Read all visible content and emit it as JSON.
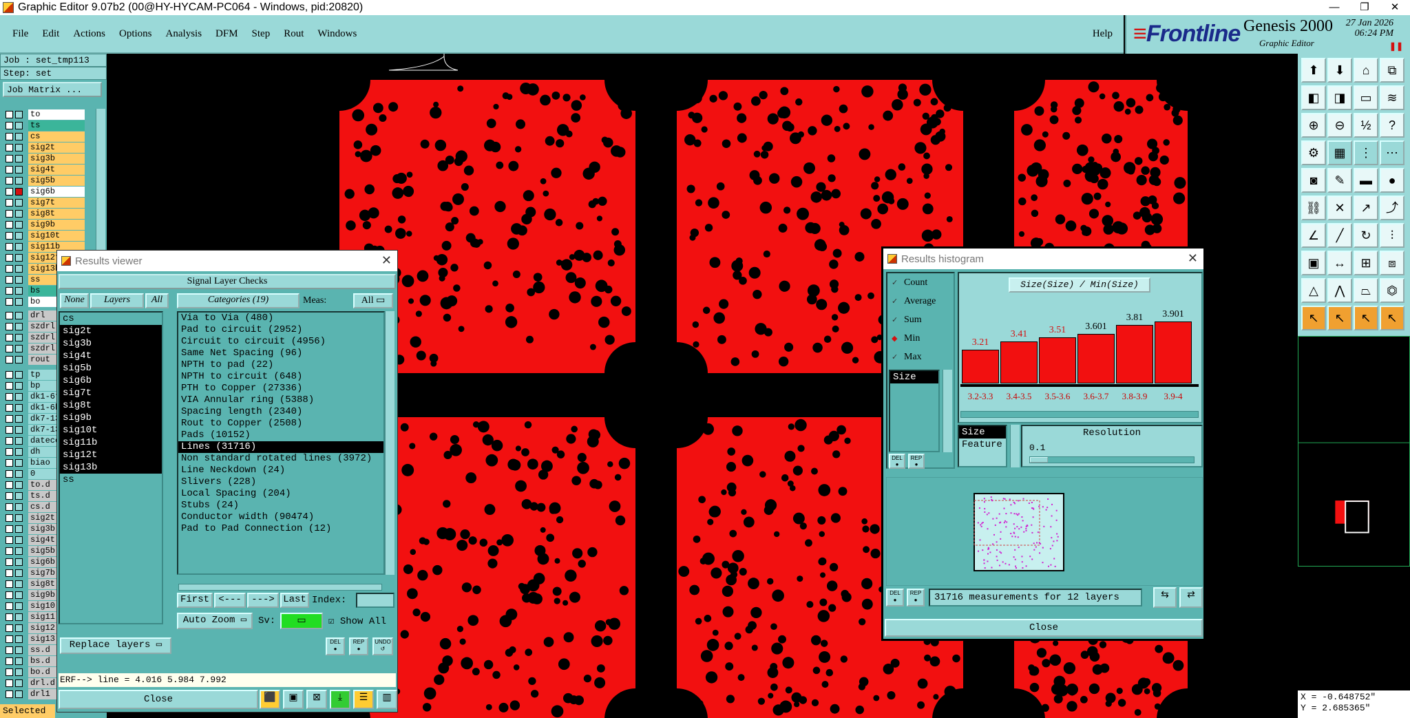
{
  "window": {
    "title": "Graphic Editor 9.07b2 (00@HY-HYCAM-PC064 - Windows, pid:20820)"
  },
  "menu": {
    "items": [
      "File",
      "Edit",
      "Actions",
      "Options",
      "Analysis",
      "DFM",
      "Step",
      "Rout",
      "Windows"
    ],
    "help": "Help"
  },
  "logo": {
    "brand": "Frontline",
    "product": "Genesis 2000",
    "subtitle": "Graphic Editor",
    "date": "27 Jan 2026",
    "time": "06:24 PM"
  },
  "job": {
    "job_label": "Job : set_tmp113",
    "step_label": "Step: set",
    "matrix_button": "Job Matrix ..."
  },
  "layers": {
    "board": [
      "to",
      "ts",
      "cs",
      "sig2t",
      "sig3b",
      "sig4t",
      "sig5b",
      "sig6b",
      "sig7t",
      "sig8t",
      "sig9b",
      "sig10t",
      "sig11b",
      "sig12t",
      "sig13b",
      "ss",
      "bs",
      "bo"
    ],
    "drill": [
      "drl",
      "szdrl",
      "szdrl",
      "szdrl",
      "rout"
    ],
    "misc": [
      "tp",
      "bp",
      "dk1-6t",
      "dk1-6b",
      "dk7-13",
      "dk7-13",
      "datecode",
      "dh",
      "biao",
      "0",
      "to.d",
      "ts.d",
      "cs.d",
      "sig2t",
      "sig3b",
      "sig4t",
      "sig5b",
      "sig6b",
      "sig7b",
      "sig8t",
      "sig9b",
      "sig10",
      "sig11",
      "sig12",
      "sig13",
      "ss.d",
      "bs.d",
      "bo.d",
      "drl.d",
      "drl1"
    ],
    "selected_label": "Selected"
  },
  "results_viewer": {
    "title": "Results viewer",
    "banner": "Signal Layer Checks",
    "none": "None",
    "layers_tab": "Layers",
    "all": "All",
    "categories_label": "Categories (19)",
    "meas_label": "Meas:",
    "meas_value": "All",
    "layer_list": [
      "cs",
      "sig2t",
      "sig3b",
      "sig4t",
      "sig5b",
      "sig6b",
      "sig7t",
      "sig8t",
      "sig9b",
      "sig10t",
      "sig11b",
      "sig12t",
      "sig13b",
      "ss"
    ],
    "categories": [
      "Via to Via (480)",
      "Pad to circuit (2952)",
      "Circuit to circuit (4956)",
      "Same Net Spacing (96)",
      "NPTH to pad (22)",
      "NPTH to circuit (648)",
      "PTH to Copper (27336)",
      "VIA Annular ring (5388)",
      "Spacing length (2340)",
      "Rout to Copper (2508)",
      "Pads (10152)",
      "Lines (31716)",
      "Non standard rotated lines (3972)",
      "Line Neckdown (24)",
      "Slivers (228)",
      "Local Spacing (204)",
      "Stubs (24)",
      "Conductor width (90474)",
      "Pad to Pad Connection (12)"
    ],
    "nav": {
      "first": "First",
      "prev": "<---",
      "next": "--->",
      "last": "Last",
      "index_label": "Index:",
      "index_value": ""
    },
    "auto_zoom": "Auto Zoom",
    "sv_label": "Sv:",
    "show_all": "Show All",
    "replace_layers": "Replace layers",
    "icons": {
      "del": "DEL",
      "rep": "REP",
      "undo": "UNDO"
    },
    "erf": "ERF--> line = 4.016 5.984 7.992",
    "close": "Close"
  },
  "histogram": {
    "title": "Results histogram",
    "options": [
      {
        "label": "Count",
        "checked": false
      },
      {
        "label": "Average",
        "checked": false
      },
      {
        "label": "Sum",
        "checked": false
      },
      {
        "label": "Min",
        "checked": true
      },
      {
        "label": "Max",
        "checked": false
      }
    ],
    "field_list_selected": "Size",
    "chart_title": "Size(Size) / Min(Size)",
    "bins": [
      {
        "value": "3.21",
        "range": "3.2-3.3",
        "red": true
      },
      {
        "value": "3.41",
        "range": "3.4-3.5",
        "red": true
      },
      {
        "value": "3.51",
        "range": "3.5-3.6",
        "red": true
      },
      {
        "value": "3.601",
        "range": "3.6-3.7",
        "red": false
      },
      {
        "value": "3.81",
        "range": "3.8-3.9",
        "red": false
      },
      {
        "value": "3.901",
        "range": "3.9-4",
        "red": false
      }
    ],
    "by_list": [
      "Size",
      "Feature"
    ],
    "resolution_label": "Resolution",
    "resolution_value": "0.1",
    "summary": "31716 measurements for 12 layers",
    "close": "Close",
    "icons": {
      "del": "DEL",
      "rep": "REP"
    }
  },
  "coords": {
    "x": "X = -0.648752\"",
    "y": "Y = 2.685365\""
  },
  "colors": {
    "panel": "#5ab4b0",
    "menu": "#9ad9d8",
    "copper": "#f21010"
  }
}
